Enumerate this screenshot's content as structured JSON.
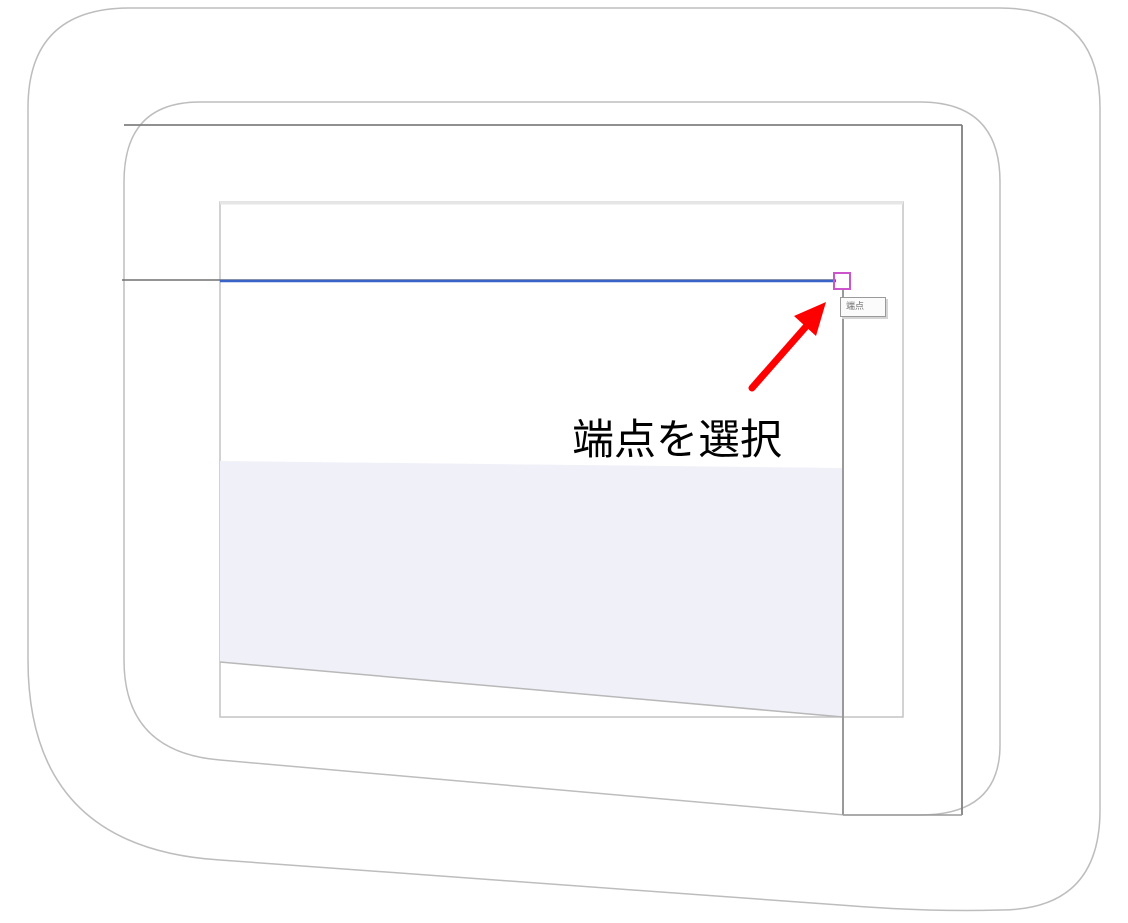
{
  "canvas": {
    "snap_tooltip": "端点",
    "annotation": "端点を選択"
  },
  "colors": {
    "selected_line": "#3a63c8",
    "snap_marker": "#cc55cc",
    "arrow": "#ff0000",
    "outline": "#bdbdbd",
    "wall_line": "#808080",
    "fill": "#f0f0f9"
  },
  "icons": {
    "snap_marker": "square-endpoint-marker",
    "arrow": "red-arrow"
  }
}
